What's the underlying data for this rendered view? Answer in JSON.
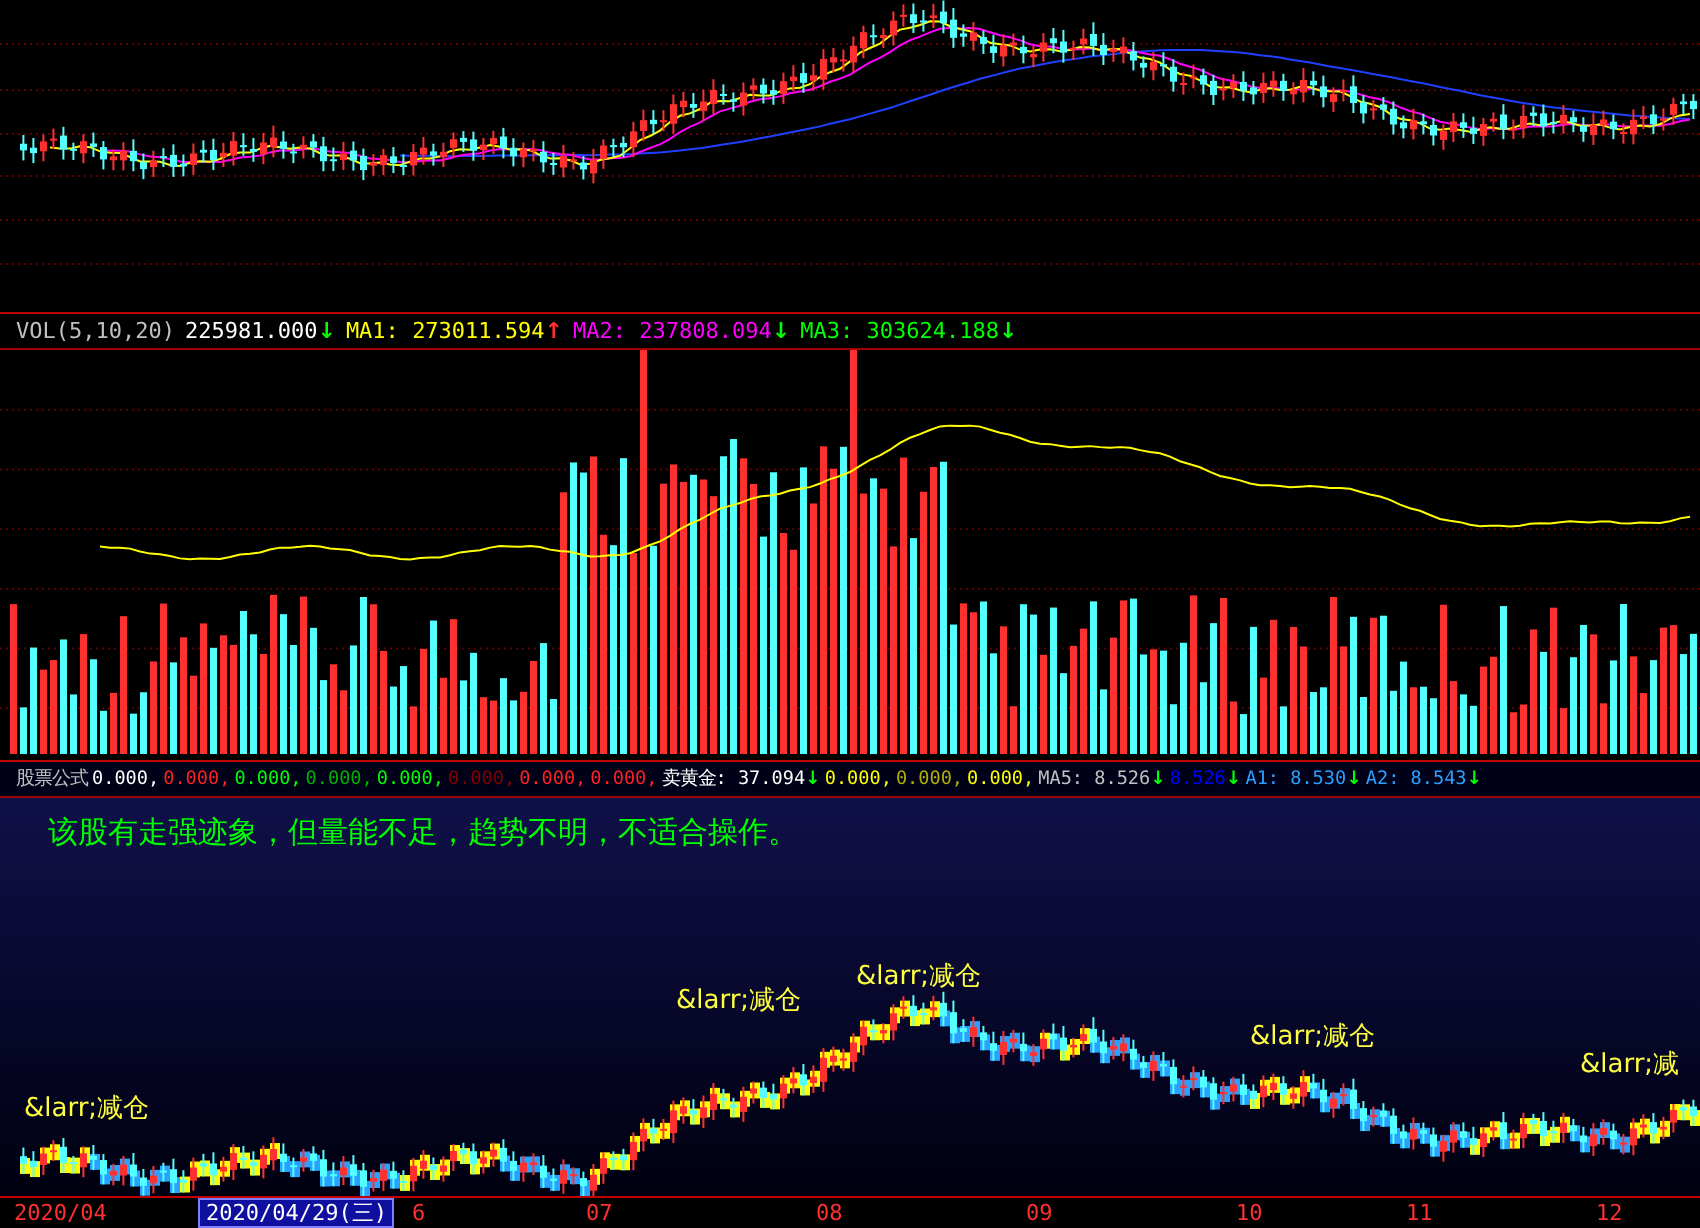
{
  "volume_header": {
    "title": "VOL(5,10,20)",
    "items": [
      {
        "value": "225981.000",
        "arrow": {
          "text": "↓",
          "color": "#00ff00"
        },
        "color": "#ffffff"
      },
      {
        "label": "MA1:",
        "value": "273011.594",
        "arrow": {
          "text": "↑",
          "color": "#ff3030"
        },
        "color": "#ffff00"
      },
      {
        "label": "MA2:",
        "value": "237808.094",
        "arrow": {
          "text": "↓",
          "color": "#00ff00"
        },
        "color": "#ff00ff"
      },
      {
        "label": "MA3:",
        "value": "303624.188",
        "arrow": {
          "text": "↓",
          "color": "#00ff00"
        },
        "color": "#00ff00"
      }
    ]
  },
  "indicator_header": {
    "title": "股票公式",
    "items": [
      {
        "value": "0.000,",
        "color": "#ffffff"
      },
      {
        "value": "0.000,",
        "color": "#ff2020"
      },
      {
        "value": "0.000,",
        "color": "#00ff00"
      },
      {
        "value": "0.000,",
        "color": "#00b000"
      },
      {
        "value": "0.000,",
        "color": "#00ff00"
      },
      {
        "value": "0.000,",
        "color": "#800000"
      },
      {
        "value": "0.000,",
        "color": "#ff2020"
      },
      {
        "value": "0.000,",
        "color": "#ff2020"
      },
      {
        "label": "卖黄金:",
        "value": "37.094",
        "arrow": {
          "text": "↓",
          "color": "#00ff00"
        },
        "color": "#ffffff"
      },
      {
        "value": "0.000,",
        "color": "#ffff00"
      },
      {
        "value": "0.000,",
        "color": "#b0b000"
      },
      {
        "value": "0.000,",
        "color": "#ffff00"
      },
      {
        "label": "MA5:",
        "value": "8.526",
        "arrow": {
          "text": "↓",
          "color": "#00ff00"
        },
        "color": "#c0c0c0"
      },
      {
        "value": "8.526",
        "arrow": {
          "text": "↓",
          "color": "#00ff00"
        },
        "color": "#0000ff"
      },
      {
        "label": "A1:",
        "value": "8.530",
        "arrow": {
          "text": "↓",
          "color": "#00ff00"
        },
        "color": "#2aa0ff"
      },
      {
        "label": "A2:",
        "value": "8.543",
        "arrow": {
          "text": "↓",
          "color": "#00ff00"
        },
        "color": "#2aa0ff"
      }
    ]
  },
  "message": "该股有走强迹象，但量能不足，趋势不明，不适合操作。",
  "annotations": [
    "&larr;减仓",
    "&larr;减仓",
    "&larr;减仓",
    "&larr;减仓",
    "&larr;减"
  ],
  "x_axis": [
    {
      "label": "2020/04",
      "selected": false
    },
    {
      "label": "2020/04/29(三)",
      "selected": true
    },
    {
      "label": "6",
      "selected": false
    },
    {
      "label": "07",
      "selected": false
    },
    {
      "label": "08",
      "selected": false
    },
    {
      "label": "09",
      "selected": false
    },
    {
      "label": "10",
      "selected": false
    },
    {
      "label": "11",
      "selected": false
    },
    {
      "label": "12",
      "selected": false
    }
  ]
}
